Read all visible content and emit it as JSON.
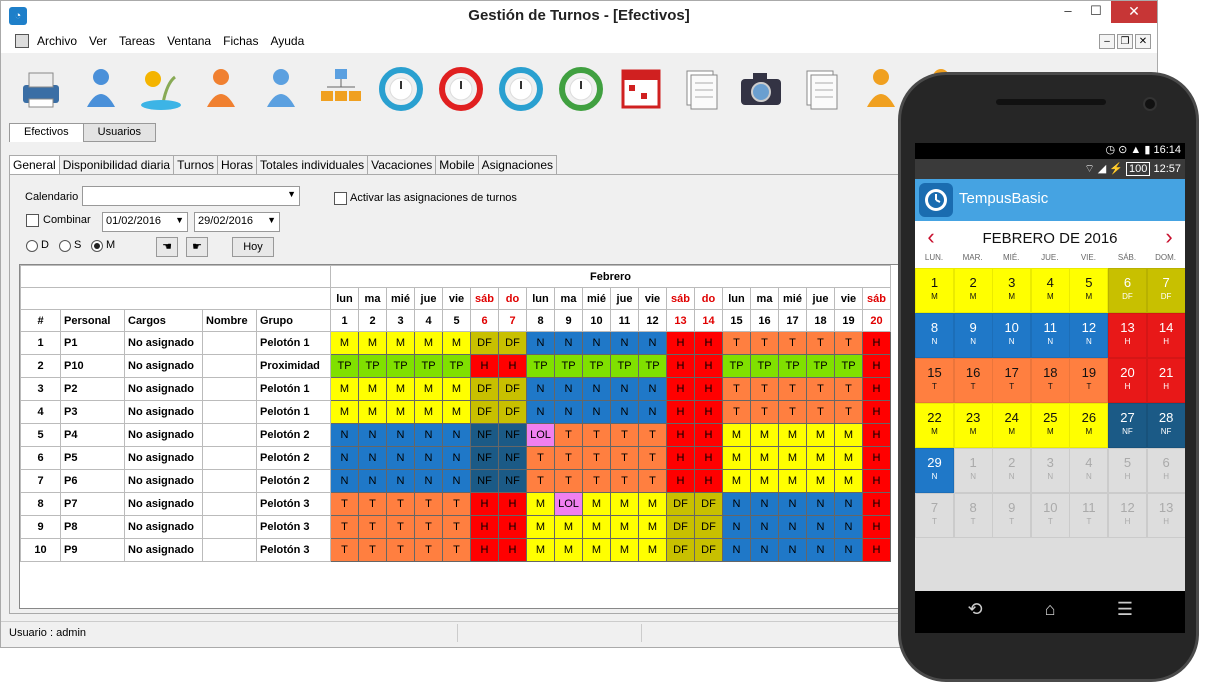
{
  "window": {
    "title": "Gestión de Turnos - [Efectivos]",
    "min_label": "–",
    "max_label": "☐",
    "close_label": "✕"
  },
  "menu": [
    "Archivo",
    "Ver",
    "Tareas",
    "Ventana",
    "Fichas",
    "Ayuda"
  ],
  "toolbar_icons": [
    "printer-icon",
    "personnel-icon",
    "holidays-icon",
    "target-person-icon",
    "group-icon",
    "org-chart-icon",
    "clock-refresh-icon",
    "alert-refresh-icon",
    "time-refresh-icon",
    "clock-down-icon",
    "calendar-icon",
    "notepad-icon",
    "camera-icon",
    "documents-icon",
    "users-icon",
    "help-icon"
  ],
  "tabs_top": [
    "Efectivos",
    "Usuarios"
  ],
  "tabs_second": [
    "General",
    "Disponibilidad diaria",
    "Turnos",
    "Horas",
    "Totales individuales",
    "Vacaciones",
    "Mobile",
    "Asignaciones"
  ],
  "form": {
    "calendario_label": "Calendario",
    "calendario_value": "",
    "combinar_label": "Combinar",
    "date_from": "01/02/2016",
    "date_to": "29/02/2016",
    "activar_label": "Activar las asignaciones de turnos",
    "radio_d": "D",
    "radio_s": "S",
    "radio_m": "M",
    "hoy_label": "Hoy"
  },
  "grid": {
    "month": "Febrero",
    "columns": [
      "#",
      "Personal",
      "Cargos",
      "Nombre",
      "Grupo"
    ],
    "weekdays": [
      "lun",
      "ma",
      "mié",
      "jue",
      "vie",
      "sáb",
      "do",
      "lun",
      "ma",
      "mié",
      "jue",
      "vie",
      "sáb",
      "do",
      "lun",
      "ma",
      "mié",
      "jue",
      "vie",
      "sáb"
    ],
    "days": [
      "1",
      "2",
      "3",
      "4",
      "5",
      "6",
      "7",
      "8",
      "9",
      "10",
      "11",
      "12",
      "13",
      "14",
      "15",
      "16",
      "17",
      "18",
      "19",
      "20"
    ],
    "weekend_days": [
      6,
      7,
      13,
      14,
      20
    ],
    "rows": [
      {
        "n": "1",
        "personal": "P1",
        "cargos": "No asignado",
        "nombre": "",
        "grupo": "Pelotón 1",
        "shifts": [
          "M",
          "M",
          "M",
          "M",
          "M",
          "DF",
          "DF",
          "N",
          "N",
          "N",
          "N",
          "N",
          "H",
          "H",
          "T",
          "T",
          "T",
          "T",
          "T",
          "H"
        ]
      },
      {
        "n": "2",
        "personal": "P10",
        "cargos": "No asignado",
        "nombre": "",
        "grupo": "Proximidad",
        "shifts": [
          "TP",
          "TP",
          "TP",
          "TP",
          "TP",
          "H",
          "H",
          "TP",
          "TP",
          "TP",
          "TP",
          "TP",
          "H",
          "H",
          "TP",
          "TP",
          "TP",
          "TP",
          "TP",
          "H"
        ]
      },
      {
        "n": "3",
        "personal": "P2",
        "cargos": "No asignado",
        "nombre": "",
        "grupo": "Pelotón 1",
        "shifts": [
          "M",
          "M",
          "M",
          "M",
          "M",
          "DF",
          "DF",
          "N",
          "N",
          "N",
          "N",
          "N",
          "H",
          "H",
          "T",
          "T",
          "T",
          "T",
          "T",
          "H"
        ]
      },
      {
        "n": "4",
        "personal": "P3",
        "cargos": "No asignado",
        "nombre": "",
        "grupo": "Pelotón 1",
        "shifts": [
          "M",
          "M",
          "M",
          "M",
          "M",
          "DF",
          "DF",
          "N",
          "N",
          "N",
          "N",
          "N",
          "H",
          "H",
          "T",
          "T",
          "T",
          "T",
          "T",
          "H"
        ]
      },
      {
        "n": "5",
        "personal": "P4",
        "cargos": "No asignado",
        "nombre": "",
        "grupo": "Pelotón 2",
        "shifts": [
          "N",
          "N",
          "N",
          "N",
          "N",
          "NF",
          "NF",
          "LOL",
          "T",
          "T",
          "T",
          "T",
          "H",
          "H",
          "M",
          "M",
          "M",
          "M",
          "M",
          "H"
        ]
      },
      {
        "n": "6",
        "personal": "P5",
        "cargos": "No asignado",
        "nombre": "",
        "grupo": "Pelotón 2",
        "shifts": [
          "N",
          "N",
          "N",
          "N",
          "N",
          "NF",
          "NF",
          "T",
          "T",
          "T",
          "T",
          "T",
          "H",
          "H",
          "M",
          "M",
          "M",
          "M",
          "M",
          "H"
        ]
      },
      {
        "n": "7",
        "personal": "P6",
        "cargos": "No asignado",
        "nombre": "",
        "grupo": "Pelotón 2",
        "shifts": [
          "N",
          "N",
          "N",
          "N",
          "N",
          "NF",
          "NF",
          "T",
          "T",
          "T",
          "T",
          "T",
          "H",
          "H",
          "M",
          "M",
          "M",
          "M",
          "M",
          "H"
        ]
      },
      {
        "n": "8",
        "personal": "P7",
        "cargos": "No asignado",
        "nombre": "",
        "grupo": "Pelotón 3",
        "shifts": [
          "T",
          "T",
          "T",
          "T",
          "T",
          "H",
          "H",
          "M",
          "LOL",
          "M",
          "M",
          "M",
          "DF",
          "DF",
          "N",
          "N",
          "N",
          "N",
          "N",
          "H"
        ]
      },
      {
        "n": "9",
        "personal": "P8",
        "cargos": "No asignado",
        "nombre": "",
        "grupo": "Pelotón 3",
        "shifts": [
          "T",
          "T",
          "T",
          "T",
          "T",
          "H",
          "H",
          "M",
          "M",
          "M",
          "M",
          "M",
          "DF",
          "DF",
          "N",
          "N",
          "N",
          "N",
          "N",
          "H"
        ]
      },
      {
        "n": "10",
        "personal": "P9",
        "cargos": "No asignado",
        "nombre": "",
        "grupo": "Pelotón 3",
        "shifts": [
          "T",
          "T",
          "T",
          "T",
          "T",
          "H",
          "H",
          "M",
          "M",
          "M",
          "M",
          "M",
          "DF",
          "DF",
          "N",
          "N",
          "N",
          "N",
          "N",
          "H"
        ]
      }
    ]
  },
  "shift_colors": {
    "M": "#ffff00",
    "N": "#1f78c8",
    "T": "#ff7f40",
    "H": "#ff0000",
    "DF": "#c8c000",
    "NF": "#1b5a86",
    "TP": "#80e000",
    "LOL": "#f080f0"
  },
  "status": {
    "user": "Usuario : admin"
  },
  "phone": {
    "time1": "16:14",
    "battery": "100",
    "time2": "12:57",
    "app_title": "TempusBasic",
    "month_title": "FEBRERO DE 2016",
    "prev": "‹",
    "next": "›",
    "weekdays": [
      "LUN.",
      "MAR.",
      "MIÉ.",
      "JUE.",
      "VIE.",
      "SÁB.",
      "DOM."
    ],
    "days": [
      {
        "n": "1",
        "s": "M"
      },
      {
        "n": "2",
        "s": "M"
      },
      {
        "n": "3",
        "s": "M"
      },
      {
        "n": "4",
        "s": "M"
      },
      {
        "n": "5",
        "s": "M"
      },
      {
        "n": "6",
        "s": "DF"
      },
      {
        "n": "7",
        "s": "DF"
      },
      {
        "n": "8",
        "s": "N"
      },
      {
        "n": "9",
        "s": "N"
      },
      {
        "n": "10",
        "s": "N"
      },
      {
        "n": "11",
        "s": "N"
      },
      {
        "n": "12",
        "s": "N"
      },
      {
        "n": "13",
        "s": "H"
      },
      {
        "n": "14",
        "s": "H"
      },
      {
        "n": "15",
        "s": "T"
      },
      {
        "n": "16",
        "s": "T"
      },
      {
        "n": "17",
        "s": "T"
      },
      {
        "n": "18",
        "s": "T"
      },
      {
        "n": "19",
        "s": "T"
      },
      {
        "n": "20",
        "s": "H"
      },
      {
        "n": "21",
        "s": "H"
      },
      {
        "n": "22",
        "s": "M"
      },
      {
        "n": "23",
        "s": "M"
      },
      {
        "n": "24",
        "s": "M"
      },
      {
        "n": "25",
        "s": "M"
      },
      {
        "n": "26",
        "s": "M"
      },
      {
        "n": "27",
        "s": "NF"
      },
      {
        "n": "28",
        "s": "NF"
      },
      {
        "n": "29",
        "s": "N"
      },
      {
        "n": "1",
        "s": "N",
        "out": true
      },
      {
        "n": "2",
        "s": "N",
        "out": true
      },
      {
        "n": "3",
        "s": "N",
        "out": true
      },
      {
        "n": "4",
        "s": "N",
        "out": true
      },
      {
        "n": "5",
        "s": "H",
        "out": true
      },
      {
        "n": "6",
        "s": "H",
        "out": true
      },
      {
        "n": "7",
        "s": "T",
        "out": true
      },
      {
        "n": "8",
        "s": "T",
        "out": true
      },
      {
        "n": "9",
        "s": "T",
        "out": true
      },
      {
        "n": "10",
        "s": "T",
        "out": true
      },
      {
        "n": "11",
        "s": "T",
        "out": true
      },
      {
        "n": "12",
        "s": "H",
        "out": true
      },
      {
        "n": "13",
        "s": "H",
        "out": true
      }
    ],
    "nav": [
      "back-icon",
      "home-icon",
      "recents-icon"
    ]
  }
}
